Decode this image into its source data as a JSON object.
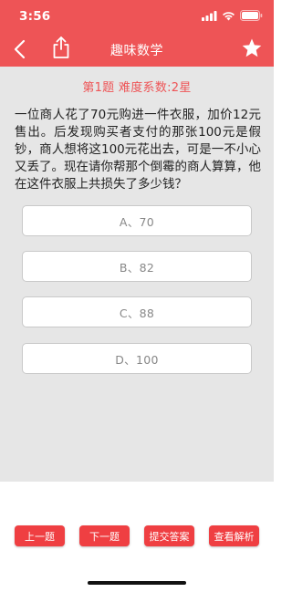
{
  "status": {
    "time": "3:56"
  },
  "nav": {
    "title": "趣味数学"
  },
  "icons": {
    "back": "back-chevron-icon",
    "share": "share-icon",
    "star": "star-icon",
    "signal": "signal-icon",
    "wifi": "wifi-icon",
    "battery": "battery-icon"
  },
  "question": {
    "meta": "第1题  难度系数:2星",
    "text": "一位商人花了70元购进一件衣服，加价12元售出。后发现购买者支付的那张100元是假钞，商人想将这100元花出去，可是一不小心又丢了。现在请你帮那个倒霉的商人算算，他在这件衣服上共损失了多少钱？",
    "options": [
      "A、70",
      "B、82",
      "C、88",
      "D、100"
    ]
  },
  "footer": {
    "prev": "上一题",
    "next": "下一题",
    "submit": "提交答案",
    "analysis": "查看解析"
  },
  "colors": {
    "accent": "#ee5456",
    "button": "#ef3f42",
    "content_bg": "#e6e6e6"
  }
}
